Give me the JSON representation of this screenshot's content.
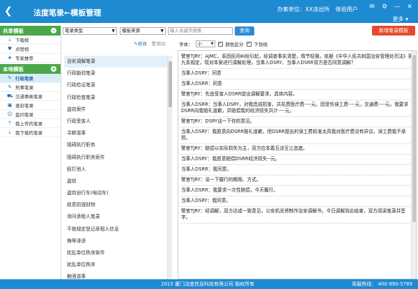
{
  "header": {
    "back_glyph": "❮",
    "title": "法度笔录←模板管理",
    "unit_label": "办案单位：XX派出所",
    "user_label": "体验用户",
    "more": "更多",
    "icons": [
      "mail-icon",
      "settings-icon",
      "minimize-icon",
      "close-icon"
    ]
  },
  "sidebar": {
    "shared_header": "共享模板",
    "shared_items": [
      {
        "label": "下载榜",
        "icon": "download-icon"
      },
      {
        "label": "点赞榜",
        "icon": "heart-icon"
      },
      {
        "label": "专家推荐",
        "icon": "star-icon"
      }
    ],
    "local_header": "本地模板",
    "local_items": [
      {
        "label": "行政笔录",
        "icon": "edit-icon",
        "active": true
      },
      {
        "label": "刑事笔录",
        "icon": "edit-icon"
      },
      {
        "label": "交通事故笔录",
        "icon": "car-icon"
      },
      {
        "label": "查封笔录",
        "icon": "seal-icon"
      },
      {
        "label": "盘问笔录",
        "icon": "person-icon"
      },
      {
        "label": "我上传的笔录",
        "icon": "upload-icon"
      },
      {
        "label": "我下载的笔录",
        "icon": "download-icon"
      }
    ]
  },
  "toolbar": {
    "type_select": "笔录类型",
    "source_select": "模板来源",
    "search_placeholder": "输入关键字搜索",
    "query_label": "查询",
    "new_label": "新增笔录模板"
  },
  "list_actions": {
    "edit": "修改",
    "delete": "删除"
  },
  "list": [
    "治安调解笔录",
    "行政勘验笔录",
    "行政检证笔录",
    "行政检查笔录",
    "盗窃案件",
    "行政受害人",
    "寻衅滋事",
    "阻碍执行职务",
    "阻碍执行职务案件",
    "殴打他人",
    "盗窃",
    "盗窃自行车(电动车)",
    "故意损毁财物",
    "询问承租人笔录",
    "不按规定登记承租人信息",
    "侮辱诽谤",
    "扰乱单位秩序案件",
    "扰乱单位秩序",
    "酗酒滋事"
  ],
  "content_toolbar": {
    "font_label": "字体：",
    "font_size": "小",
    "color_label": "颜色区分",
    "underline_label": "下划线"
  },
  "document": [
    "警官TJRY：AJMC，系因民间纠纷引起，经调查事实清楚，情节轻微，依据《中华人民共和国治安管理处罚法》第九条规定，现对本案进行调解处理，当事人DSRY、当事人DSRR双方是否同意调解？",
    "当事人DSRY：同意",
    "当事人DSRR：同意",
    "警官TJRY：先由受害人DSRR提出调解要求，具体内容。",
    "当事人DSRR：当事人DSRY，对我造成损害，共花费医疗费----元，因受伤误工费----元，交通费----元，我要求DSRR向我赔礼道歉，并赔偿我的经济损失共计----元。",
    "警官TJRY：DSRY谈一下你的意见。",
    "当事人DSRY：我愿意向DSRR赔礼道歉，但DSRR提出的误工费标准太高我对医疗费没有异议，误工费我不承担。",
    "警官TJRY：赔偿以实际损失为主，双方应本着互谅互让态度。",
    "当事人DSRY：我愿意赔偿DSRR经济损失--元。",
    "当事人DSRR：我同意。",
    "警官TJRY：谈一下履行的期限、方式。",
    "当事人DSRR：我要求一次性赔偿，今天履行。",
    "当事人DSRY：我同意。",
    "警官TJRY：经调解，双方达成一致意见，公安机关将制作治安调解书。今日调解到此结束，双方阅读笔录并签字。"
  ],
  "footer": {
    "copyright": "2015 厦门法度信息科技有限公司 版权所有",
    "hotline": "客服热线： 400-990-5769"
  },
  "colors": {
    "primary": "#1d8ad2",
    "sidebar_header": "#4aa84a",
    "new_button": "#e64a2e"
  }
}
